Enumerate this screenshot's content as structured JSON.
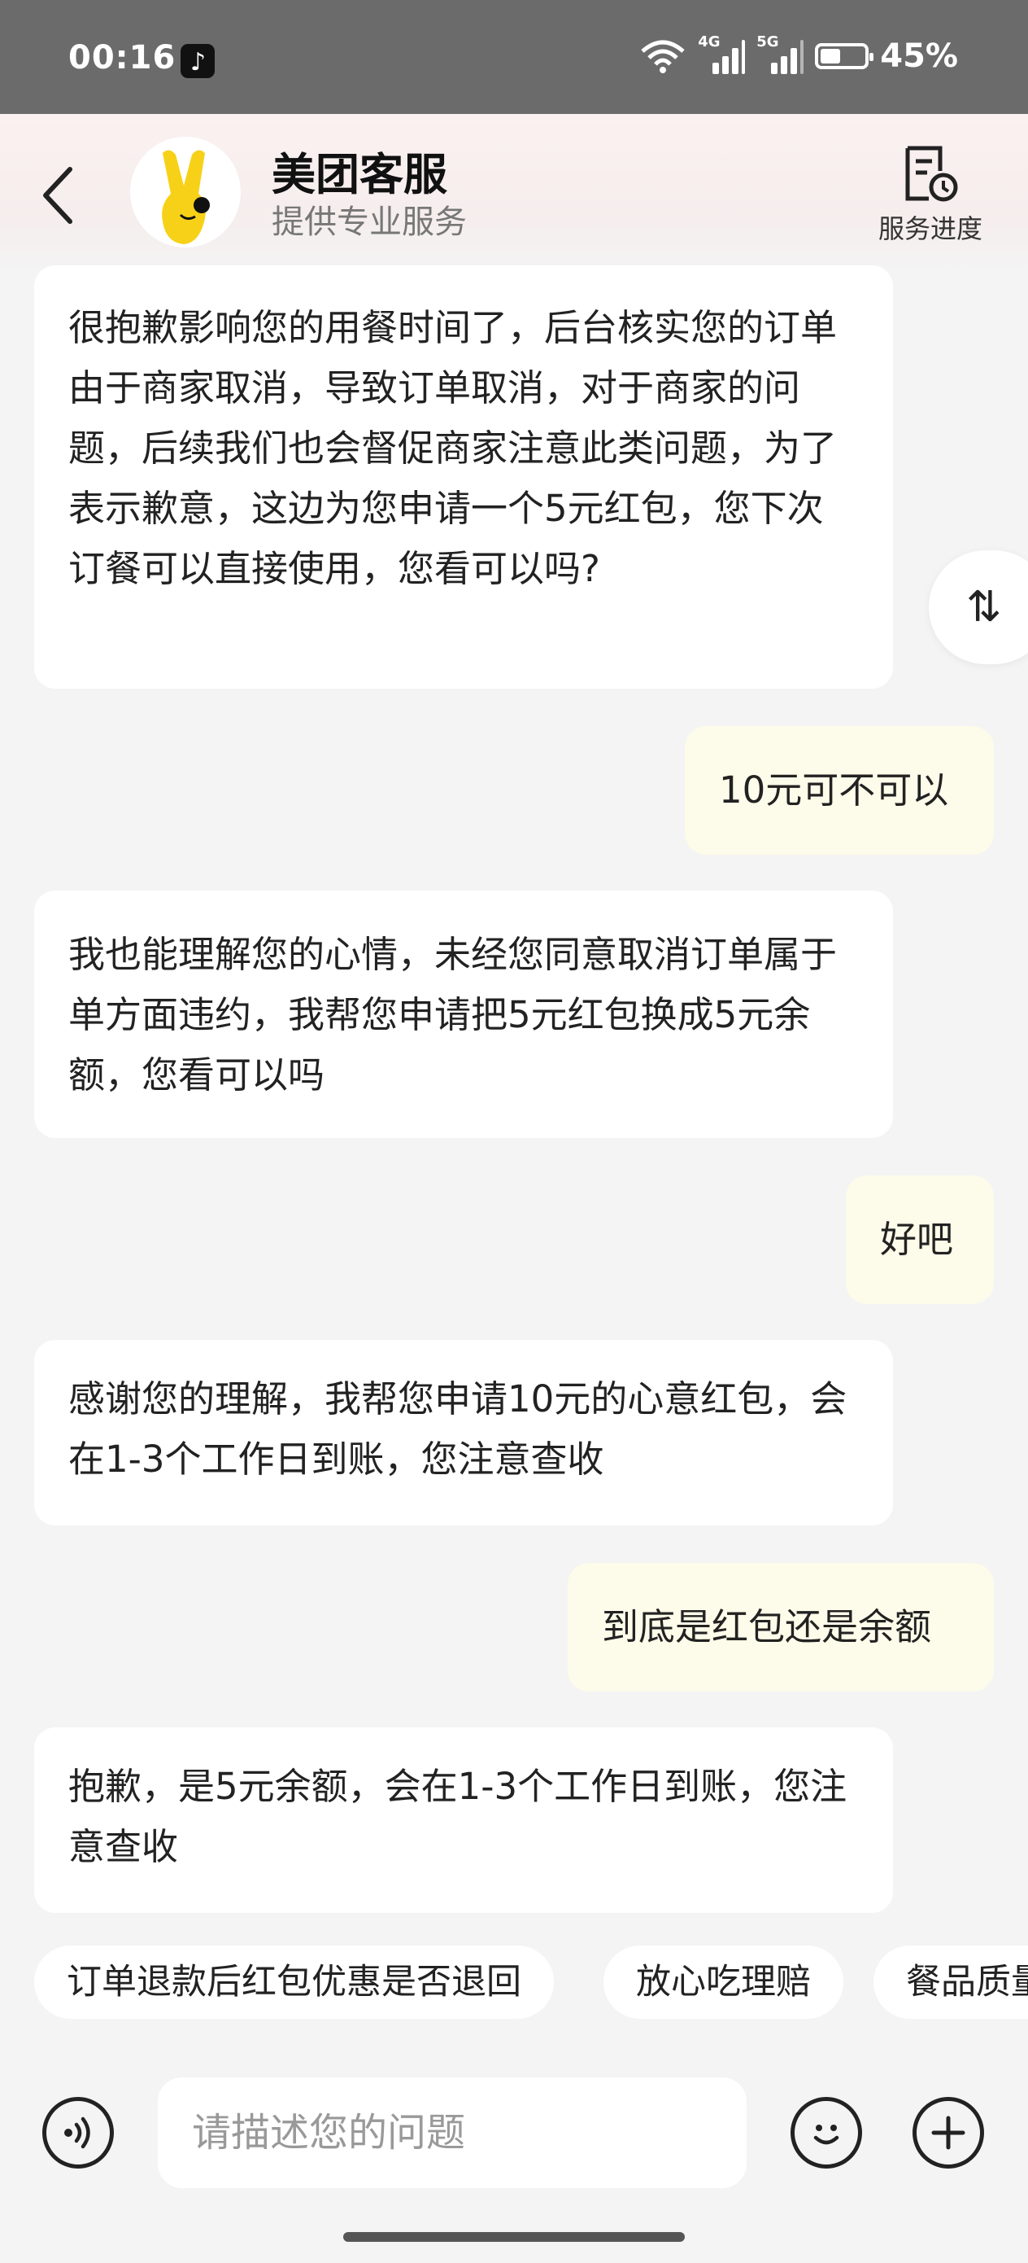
{
  "status_bar": {
    "time": "00:16",
    "network1": "4G",
    "network2": "5G",
    "battery": "45%",
    "battery_level": 0.45
  },
  "header": {
    "title": "美团客服",
    "subtitle": "提供专业服务",
    "progress_label": "服务进度"
  },
  "messages": [
    {
      "from": "agent",
      "text": "很抱歉影响您的用餐时间了，后台核实您的订单由于商家取消，导致订单取消，对于商家的问题，后续我们也会督促商家注意此类问题，为了表示歉意，这边为您申请一个5元红包，您下次订餐可以直接使用，您看可以吗?"
    },
    {
      "from": "user",
      "text": "10元可不可以"
    },
    {
      "from": "agent",
      "text": "我也能理解您的心情，未经您同意取消订单属于单方面违约，我帮您申请把5元红包换成5元余额，您看可以吗"
    },
    {
      "from": "user",
      "text": "好吧"
    },
    {
      "from": "agent",
      "text": "感谢您的理解，我帮您申请10元的心意红包，会在1-3个工作日到账，您注意查收"
    },
    {
      "from": "user",
      "text": "到底是红包还是余额"
    },
    {
      "from": "agent",
      "text": "抱歉，是5元余额，会在1-3个工作日到账，您注意查收"
    }
  ],
  "scroll_button": "⇅",
  "quick_replies": [
    "订单退款后红包优惠是否退回",
    "放心吃理赔",
    "餐品质量"
  ],
  "input": {
    "placeholder": "请描述您的问题"
  },
  "colors": {
    "agent_bubble": "#ffffff",
    "user_bubble": "#fdfbe9",
    "background": "#f4f4f4",
    "mascot_yellow": "#f7d117"
  }
}
